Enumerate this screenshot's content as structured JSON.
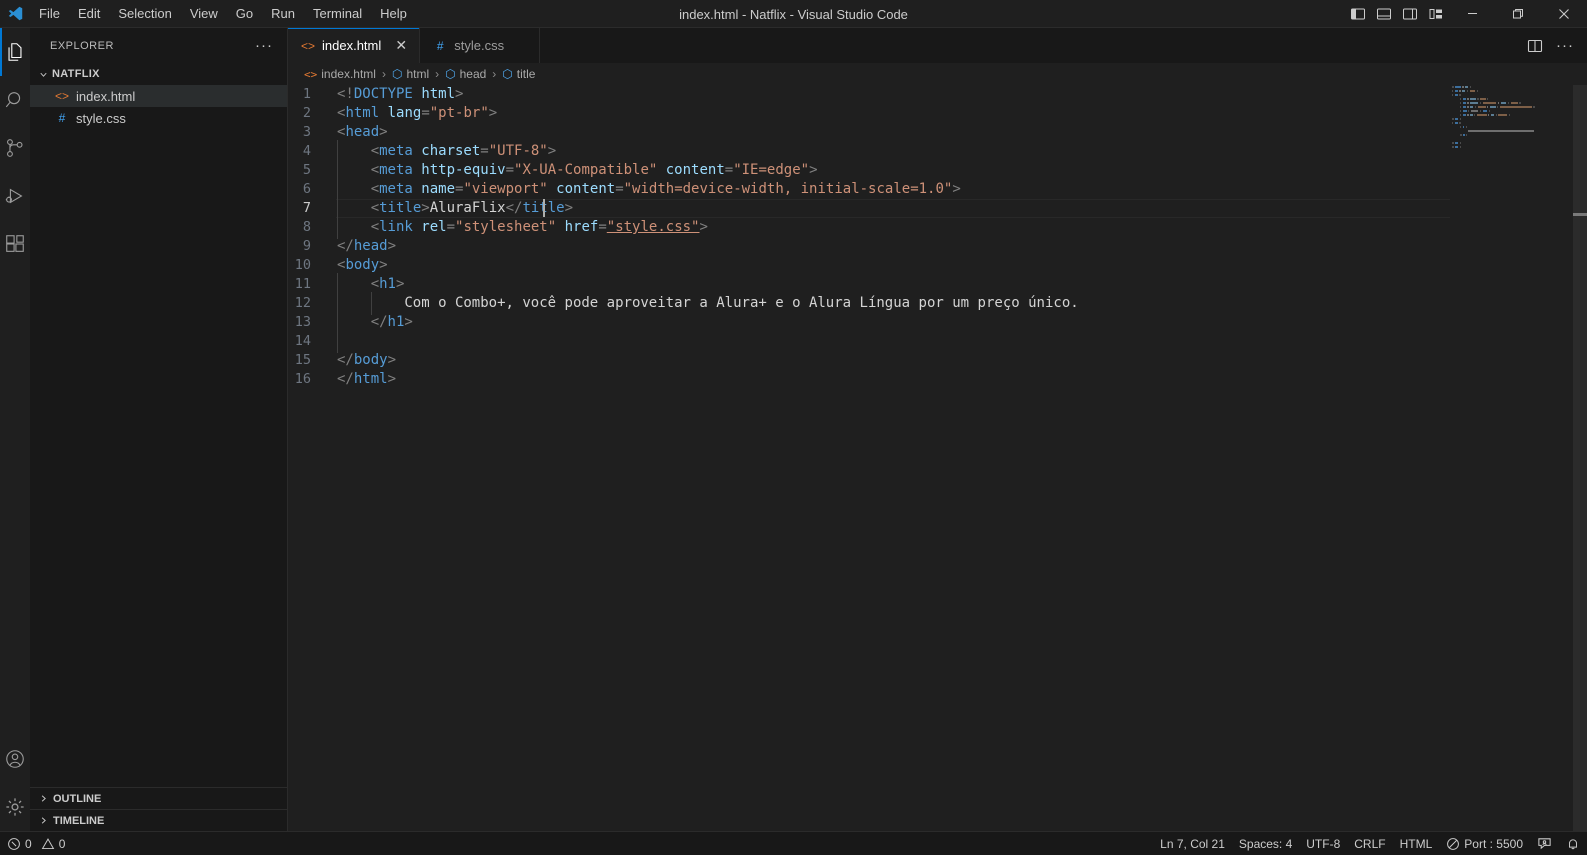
{
  "window": {
    "title": "index.html - Natflix - Visual Studio Code",
    "logo_icon": "vscode-logo-icon"
  },
  "menubar": {
    "items": [
      {
        "label": "File"
      },
      {
        "label": "Edit"
      },
      {
        "label": "Selection"
      },
      {
        "label": "View"
      },
      {
        "label": "Go"
      },
      {
        "label": "Run"
      },
      {
        "label": "Terminal"
      },
      {
        "label": "Help"
      }
    ]
  },
  "title_controls": {
    "layout": [
      {
        "name": "toggle-primary-sidebar-icon"
      },
      {
        "name": "toggle-panel-icon"
      },
      {
        "name": "toggle-secondary-sidebar-icon"
      },
      {
        "name": "customize-layout-icon"
      }
    ],
    "minimize": "—",
    "maximize": "❐",
    "close": "✕"
  },
  "activitybar": {
    "items": [
      {
        "name": "explorer",
        "icon": "files-icon",
        "active": true
      },
      {
        "name": "search",
        "icon": "search-icon",
        "active": false
      },
      {
        "name": "source-control",
        "icon": "source-control-icon",
        "active": false
      },
      {
        "name": "run-and-debug",
        "icon": "run-debug-icon",
        "active": false
      },
      {
        "name": "extensions",
        "icon": "extensions-icon",
        "active": false
      }
    ],
    "bottom": [
      {
        "name": "accounts",
        "icon": "account-icon"
      },
      {
        "name": "manage-settings",
        "icon": "gear-icon"
      }
    ]
  },
  "sidebar": {
    "title": "EXPLORER",
    "more_actions": "···",
    "folder": {
      "label": "NATFLIX",
      "expanded": true,
      "chevron": "⌄"
    },
    "files": [
      {
        "label": "index.html",
        "icon": "html-file-icon",
        "glyph": "<>",
        "color": "#e37933",
        "selected": true
      },
      {
        "label": "style.css",
        "icon": "css-file-icon",
        "glyph": "#",
        "color": "#42a5f5",
        "selected": false
      }
    ],
    "collapsed_panes": [
      {
        "label": "OUTLINE",
        "chevron": "›"
      },
      {
        "label": "TIMELINE",
        "chevron": "›"
      }
    ]
  },
  "tabs": [
    {
      "label": "index.html",
      "glyph": "<>",
      "color": "#e37933",
      "active": true,
      "close": "✕"
    },
    {
      "label": "style.css",
      "glyph": "#",
      "color": "#42a5f5",
      "active": false,
      "close": ""
    }
  ],
  "editor_actions": [
    {
      "name": "split-editor-right-icon"
    },
    {
      "name": "more-actions-icon",
      "label": "···"
    }
  ],
  "breadcrumbs": {
    "items": [
      {
        "label": "index.html",
        "glyph": "<>",
        "color": "#e37933"
      },
      {
        "label": "html",
        "glyph": "⬡",
        "color": "#4fa6ea"
      },
      {
        "label": "head",
        "glyph": "⬡",
        "color": "#4fa6ea"
      },
      {
        "label": "title",
        "glyph": "⬡",
        "color": "#4fa6ea"
      }
    ],
    "separator": "›"
  },
  "code": {
    "language": "html",
    "active_line": 7,
    "lines": [
      {
        "n": 1,
        "indent": 0,
        "tokens": [
          {
            "t": "punct",
            "v": "<!"
          },
          {
            "t": "doctype-kw",
            "v": "DOCTYPE"
          },
          {
            "t": "txt",
            "v": " "
          },
          {
            "t": "attr",
            "v": "html"
          },
          {
            "t": "punct",
            "v": ">"
          }
        ]
      },
      {
        "n": 2,
        "indent": 0,
        "tokens": [
          {
            "t": "punct",
            "v": "<"
          },
          {
            "t": "tag",
            "v": "html"
          },
          {
            "t": "txt",
            "v": " "
          },
          {
            "t": "attr",
            "v": "lang"
          },
          {
            "t": "punct",
            "v": "="
          },
          {
            "t": "str",
            "v": "\"pt-br\""
          },
          {
            "t": "punct",
            "v": ">"
          }
        ]
      },
      {
        "n": 3,
        "indent": 0,
        "tokens": [
          {
            "t": "punct",
            "v": "<"
          },
          {
            "t": "tag",
            "v": "head"
          },
          {
            "t": "punct",
            "v": ">"
          }
        ]
      },
      {
        "n": 4,
        "indent": 1,
        "tokens": [
          {
            "t": "punct",
            "v": "<"
          },
          {
            "t": "tag",
            "v": "meta"
          },
          {
            "t": "txt",
            "v": " "
          },
          {
            "t": "attr",
            "v": "charset"
          },
          {
            "t": "punct",
            "v": "="
          },
          {
            "t": "str",
            "v": "\"UTF-8\""
          },
          {
            "t": "punct",
            "v": ">"
          }
        ]
      },
      {
        "n": 5,
        "indent": 1,
        "tokens": [
          {
            "t": "punct",
            "v": "<"
          },
          {
            "t": "tag",
            "v": "meta"
          },
          {
            "t": "txt",
            "v": " "
          },
          {
            "t": "attr",
            "v": "http-equiv"
          },
          {
            "t": "punct",
            "v": "="
          },
          {
            "t": "str",
            "v": "\"X-UA-Compatible\""
          },
          {
            "t": "txt",
            "v": " "
          },
          {
            "t": "attr",
            "v": "content"
          },
          {
            "t": "punct",
            "v": "="
          },
          {
            "t": "str",
            "v": "\"IE=edge\""
          },
          {
            "t": "punct",
            "v": ">"
          }
        ]
      },
      {
        "n": 6,
        "indent": 1,
        "tokens": [
          {
            "t": "punct",
            "v": "<"
          },
          {
            "t": "tag",
            "v": "meta"
          },
          {
            "t": "txt",
            "v": " "
          },
          {
            "t": "attr",
            "v": "name"
          },
          {
            "t": "punct",
            "v": "="
          },
          {
            "t": "str",
            "v": "\"viewport\""
          },
          {
            "t": "txt",
            "v": " "
          },
          {
            "t": "attr",
            "v": "content"
          },
          {
            "t": "punct",
            "v": "="
          },
          {
            "t": "str",
            "v": "\"width=device-width, initial-scale=1.0\""
          },
          {
            "t": "punct",
            "v": ">"
          }
        ]
      },
      {
        "n": 7,
        "indent": 1,
        "tokens": [
          {
            "t": "punct",
            "v": "<"
          },
          {
            "t": "tag",
            "v": "title"
          },
          {
            "t": "punct",
            "v": ">"
          },
          {
            "t": "txt",
            "v": "AluraFlix"
          },
          {
            "t": "punct",
            "v": "</"
          },
          {
            "t": "tag",
            "v": "title"
          },
          {
            "t": "punct",
            "v": ">"
          }
        ]
      },
      {
        "n": 8,
        "indent": 1,
        "tokens": [
          {
            "t": "punct",
            "v": "<"
          },
          {
            "t": "tag",
            "v": "link"
          },
          {
            "t": "txt",
            "v": " "
          },
          {
            "t": "attr",
            "v": "rel"
          },
          {
            "t": "punct",
            "v": "="
          },
          {
            "t": "str",
            "v": "\"stylesheet\""
          },
          {
            "t": "txt",
            "v": " "
          },
          {
            "t": "attr",
            "v": "href"
          },
          {
            "t": "punct",
            "v": "="
          },
          {
            "t": "str link-u",
            "v": "\"style.css\""
          },
          {
            "t": "punct",
            "v": ">"
          }
        ]
      },
      {
        "n": 9,
        "indent": 0,
        "tokens": [
          {
            "t": "punct",
            "v": "</"
          },
          {
            "t": "tag",
            "v": "head"
          },
          {
            "t": "punct",
            "v": ">"
          }
        ]
      },
      {
        "n": 10,
        "indent": 0,
        "tokens": [
          {
            "t": "punct",
            "v": "<"
          },
          {
            "t": "tag",
            "v": "body"
          },
          {
            "t": "punct",
            "v": ">"
          }
        ]
      },
      {
        "n": 11,
        "indent": 1,
        "tokens": [
          {
            "t": "punct",
            "v": "<"
          },
          {
            "t": "tag",
            "v": "h1"
          },
          {
            "t": "punct",
            "v": ">"
          }
        ]
      },
      {
        "n": 12,
        "indent": 2,
        "tokens": [
          {
            "t": "txt",
            "v": "Com o Combo+, você pode aproveitar a Alura+ e o Alura Língua por um preço único."
          }
        ]
      },
      {
        "n": 13,
        "indent": 1,
        "tokens": [
          {
            "t": "punct",
            "v": "</"
          },
          {
            "t": "tag",
            "v": "h1"
          },
          {
            "t": "punct",
            "v": ">"
          }
        ]
      },
      {
        "n": 14,
        "indent": 1,
        "tokens": []
      },
      {
        "n": 15,
        "indent": 0,
        "tokens": [
          {
            "t": "punct",
            "v": "</"
          },
          {
            "t": "tag",
            "v": "body"
          },
          {
            "t": "punct",
            "v": ">"
          }
        ]
      },
      {
        "n": 16,
        "indent": 0,
        "tokens": [
          {
            "t": "punct",
            "v": "</"
          },
          {
            "t": "tag",
            "v": "html"
          },
          {
            "t": "punct",
            "v": ">"
          }
        ]
      }
    ]
  },
  "statusbar": {
    "left": [
      {
        "name": "problems",
        "icon": "error-icon",
        "errors": "0",
        "warn_icon": "warning-icon",
        "warnings": "0"
      }
    ],
    "right": [
      {
        "name": "editor-position",
        "label": "Ln 7, Col 21"
      },
      {
        "name": "indentation",
        "label": "Spaces: 4"
      },
      {
        "name": "encoding",
        "label": "UTF-8"
      },
      {
        "name": "eol",
        "label": "CRLF"
      },
      {
        "name": "language-mode",
        "label": "HTML"
      },
      {
        "name": "live-server-port",
        "label": "Port : 5500",
        "icon": "broadcast-icon"
      },
      {
        "name": "feedback",
        "icon": "feedback-icon"
      },
      {
        "name": "notifications",
        "icon": "bell-icon"
      }
    ]
  },
  "colors": {
    "accent": "#0078d4",
    "tag": "#569cd6",
    "attribute": "#9cdcfe",
    "string": "#ce9178",
    "editor_bg": "#1f1f1f",
    "sidebar_bg": "#181818"
  }
}
